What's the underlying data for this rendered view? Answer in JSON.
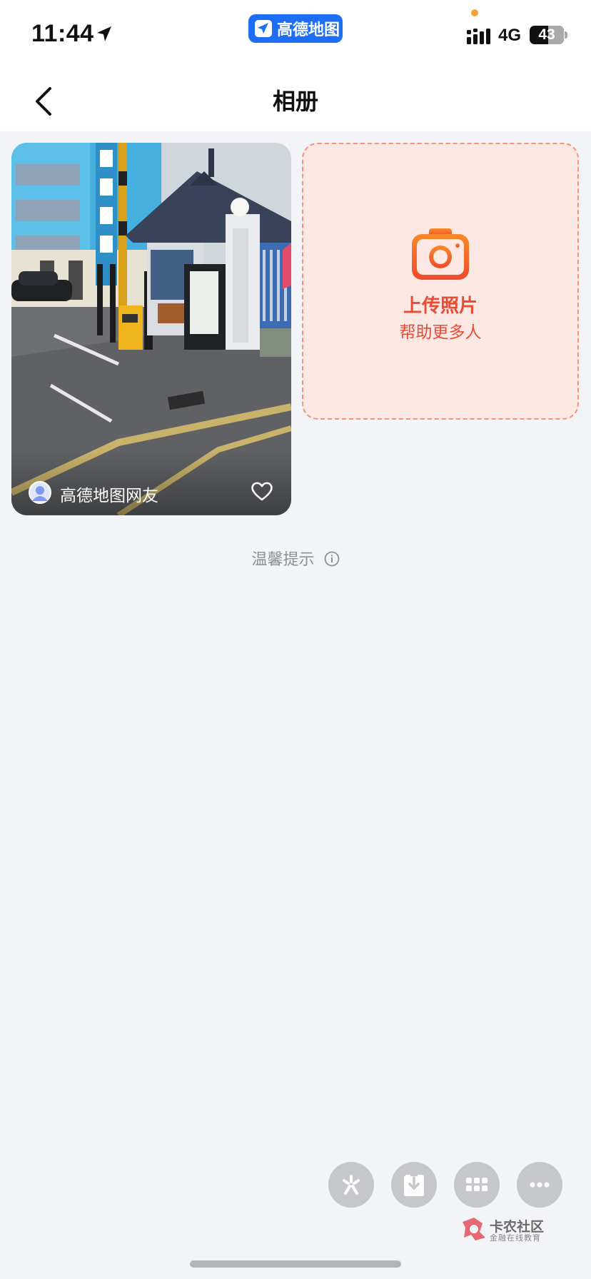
{
  "status_bar": {
    "time": "11:44",
    "app_pill_label": "高德地图",
    "network": "4G",
    "battery": "43"
  },
  "nav": {
    "title": "相册"
  },
  "photo": {
    "uploader": "高德地图网友"
  },
  "upload": {
    "title": "上传照片",
    "subtitle": "帮助更多人"
  },
  "tips": {
    "label": "温馨提示"
  },
  "watermark": {
    "title": "卡农社区",
    "subtitle": "金融在线教育"
  },
  "colors": {
    "accent_orange": "#e94b35",
    "upload_bg": "#fde8e3",
    "brand_blue": "#1e6ef5",
    "page_bg": "#f3f4f7"
  }
}
